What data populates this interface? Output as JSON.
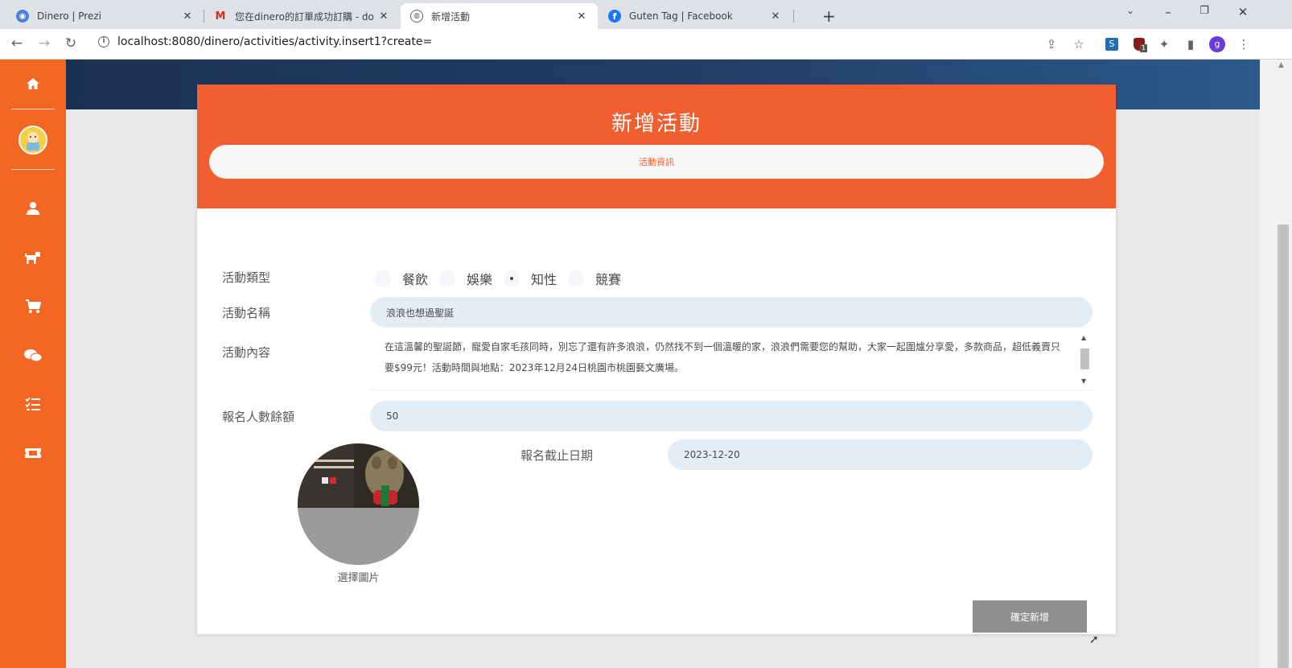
{
  "browser": {
    "tabs": [
      {
        "title": "Dinero | Prezi",
        "favicon": "prezi-icon",
        "active": false
      },
      {
        "title": "您在dinero的訂單成功訂購 - do",
        "favicon": "gmail-icon",
        "active": false
      },
      {
        "title": "新增活動",
        "favicon": "globe-icon",
        "active": true
      },
      {
        "title": "Guten Tag | Facebook",
        "favicon": "facebook-icon",
        "active": false
      }
    ],
    "url": "localhost:8080/dinero/activities/activity.insert1?create=",
    "profile_initial": "g",
    "extension_badge": "1"
  },
  "sidebar": {
    "items": [
      "home-icon",
      "user-icon",
      "dog-icon",
      "cart-icon",
      "chat-icon",
      "checklist-icon",
      "ticket-icon"
    ],
    "accent": "#f26724"
  },
  "form": {
    "title": "新增活動",
    "section_pill": "活動資訊",
    "type_label": "活動類型",
    "type_options": [
      "餐飲",
      "娛樂",
      "知性",
      "競賽"
    ],
    "type_selected": "知性",
    "name_label": "活動名稱",
    "name_value": "浪浪也想過聖誕",
    "content_label": "活動內容",
    "content_value": "在這溫馨的聖誕節，寵愛自家毛孩同時，別忘了還有許多浪浪，仍然找不到一個溫暖的家，浪浪們需要您的幫助，大家一起圍爐分享愛，多款商品，超低義賣只要$99元！活動時間與地點：2023年12月24日桃園市桃園藝文廣場。",
    "quota_label": "報名人數餘額",
    "quota_value": "50",
    "deadline_label": "報名截止日期",
    "deadline_value": "2023-12-20",
    "photo_caption": "選擇圖片",
    "submit_label": "確定新增",
    "header_color": "#f15f30"
  }
}
